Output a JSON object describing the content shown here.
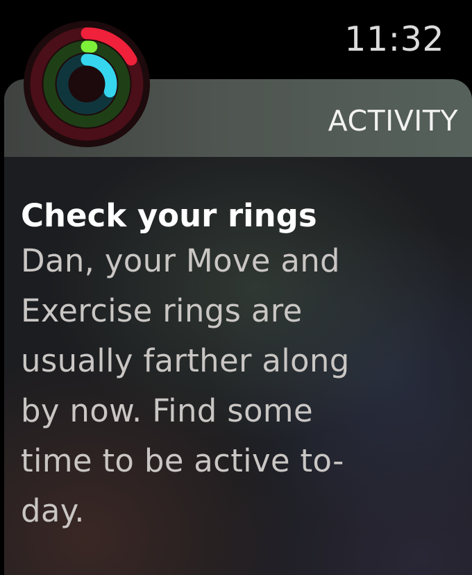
{
  "status_bar": {
    "time": "11:32"
  },
  "notification": {
    "app_name": "ACTIVITY",
    "app_icon": "activity-rings-icon",
    "title": "Check your rings",
    "body": "Dan, your Move and\nExercise rings are\nusually farther along\nby now. Find some\ntime to be active to-\nday.",
    "rings": {
      "move": {
        "progress": 0.17,
        "color": "#f0213b",
        "track_color": "#4a0f18"
      },
      "exercise": {
        "progress": 0.02,
        "color": "#7df03a",
        "track_color": "#1f4016"
      },
      "stand": {
        "progress": 0.3,
        "color": "#36d6ef",
        "track_color": "#10363d"
      }
    }
  }
}
